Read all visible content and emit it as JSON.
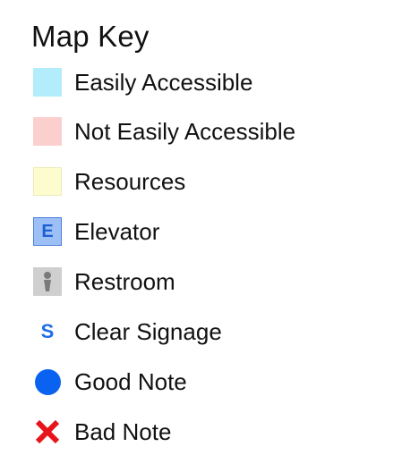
{
  "map_key": {
    "title": "Map Key",
    "items": [
      {
        "label": "Easily Accessible",
        "icon": "easily-accessible-swatch",
        "color": "#b3ecfb"
      },
      {
        "label": "Not Easily Accessible",
        "icon": "not-easily-accessible-swatch",
        "color": "#fccfcf"
      },
      {
        "label": "Resources",
        "icon": "resources-swatch",
        "color": "#fdfccf"
      },
      {
        "label": "Elevator",
        "icon": "elevator-icon",
        "glyph": "E",
        "color": "#9cc0f6"
      },
      {
        "label": "Restroom",
        "icon": "restroom-icon",
        "color": "#cfcfcf"
      },
      {
        "label": "Clear Signage",
        "icon": "signage-icon",
        "glyph": "S",
        "color": "#1f6ee8"
      },
      {
        "label": "Good Note",
        "icon": "good-note-dot-icon",
        "color": "#0a63f0"
      },
      {
        "label": "Bad Note",
        "icon": "bad-note-x-icon",
        "color": "#e8141b"
      }
    ]
  }
}
